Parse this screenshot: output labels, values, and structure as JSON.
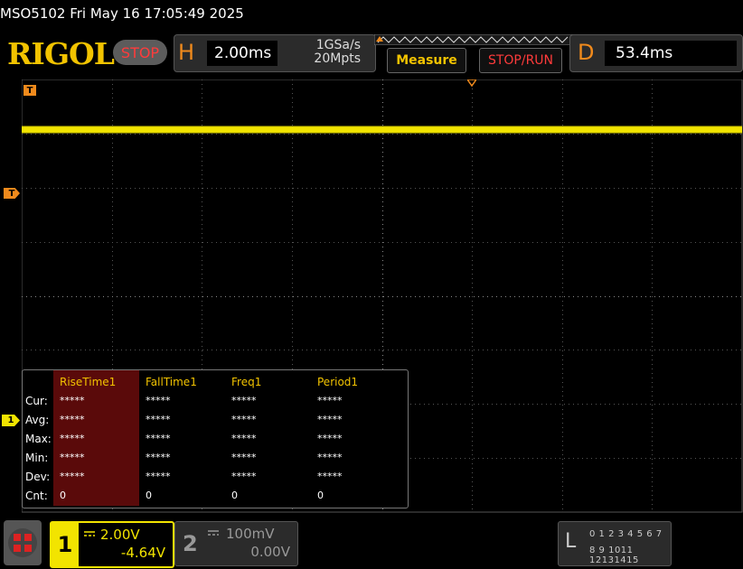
{
  "header": {
    "title": "MSO5102  Fri May 16 17:05:49 2025",
    "logo": "RIGOL",
    "run_state": "STOP"
  },
  "horizontal": {
    "letter": "H",
    "timebase": "2.00ms",
    "sample_rate": "1GSa/s",
    "memory_depth": "20Mpts"
  },
  "toolbar": {
    "measure_label": "Measure",
    "stoprun_label": "STOP/RUN"
  },
  "delay": {
    "letter": "D",
    "value": "53.4ms"
  },
  "markers": {
    "trigger_level": "T",
    "trigger_pos": "T",
    "channel1": "1"
  },
  "measurements": {
    "headers": [
      "RiseTime1",
      "FallTime1",
      "Freq1",
      "Period1"
    ],
    "rows": [
      {
        "label": "Cur:",
        "values": [
          "*****",
          "*****",
          "*****",
          "*****"
        ]
      },
      {
        "label": "Avg:",
        "values": [
          "*****",
          "*****",
          "*****",
          "*****"
        ]
      },
      {
        "label": "Max:",
        "values": [
          "*****",
          "*****",
          "*****",
          "*****"
        ]
      },
      {
        "label": "Min:",
        "values": [
          "*****",
          "*****",
          "*****",
          "*****"
        ]
      },
      {
        "label": "Dev:",
        "values": [
          "*****",
          "*****",
          "*****",
          "*****"
        ]
      },
      {
        "label": "Cnt:",
        "values": [
          "0",
          "0",
          "0",
          "0"
        ]
      }
    ]
  },
  "channels": {
    "ch1": {
      "number": "1",
      "scale": "2.00V",
      "offset": "-4.64V",
      "color": "#f2e400"
    },
    "ch2": {
      "number": "2",
      "scale": "100mV",
      "offset": "0.00V",
      "color": "#999999"
    }
  },
  "logic": {
    "letter": "L",
    "row1": "0 1 2 3  4 5 6 7",
    "row2": "8 9 1011 12131415"
  },
  "colors": {
    "accent": "#f08a1c",
    "trace": "#f2e400",
    "stop": "#ff3b3b",
    "highlight": "#5a0a0a"
  }
}
